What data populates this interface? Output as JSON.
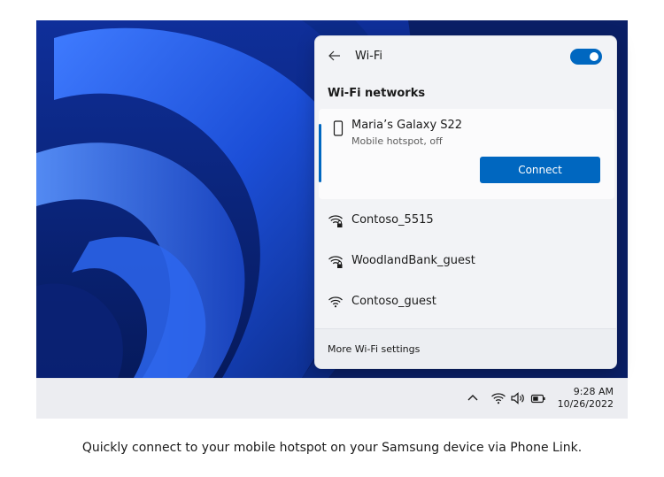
{
  "flyout": {
    "title": "Wi-Fi",
    "toggle_on": true,
    "section_title": "Wi-Fi networks",
    "selected_network": {
      "name": "Maria’s Galaxy S22",
      "status": "Mobile hotspot, off",
      "icon": "phone-icon",
      "connect_label": "Connect"
    },
    "networks": [
      {
        "name": "Contoso_5515",
        "icon": "wifi-secured-icon"
      },
      {
        "name": "WoodlandBank_guest",
        "icon": "wifi-secured-icon"
      },
      {
        "name": "Contoso_guest",
        "icon": "wifi-icon"
      }
    ],
    "footer_link": "More Wi-Fi settings"
  },
  "taskbar": {
    "tray_icons": [
      "chevron-up-icon",
      "wifi-icon",
      "volume-icon",
      "battery-icon"
    ],
    "time": "9:28 AM",
    "date": "10/26/2022"
  },
  "caption": "Quickly connect to your mobile hotspot on your Samsung device via Phone Link.",
  "colors": {
    "accent": "#0067c0",
    "flyout_bg": "#f2f3f6",
    "taskbar_bg": "#ecedf1"
  }
}
